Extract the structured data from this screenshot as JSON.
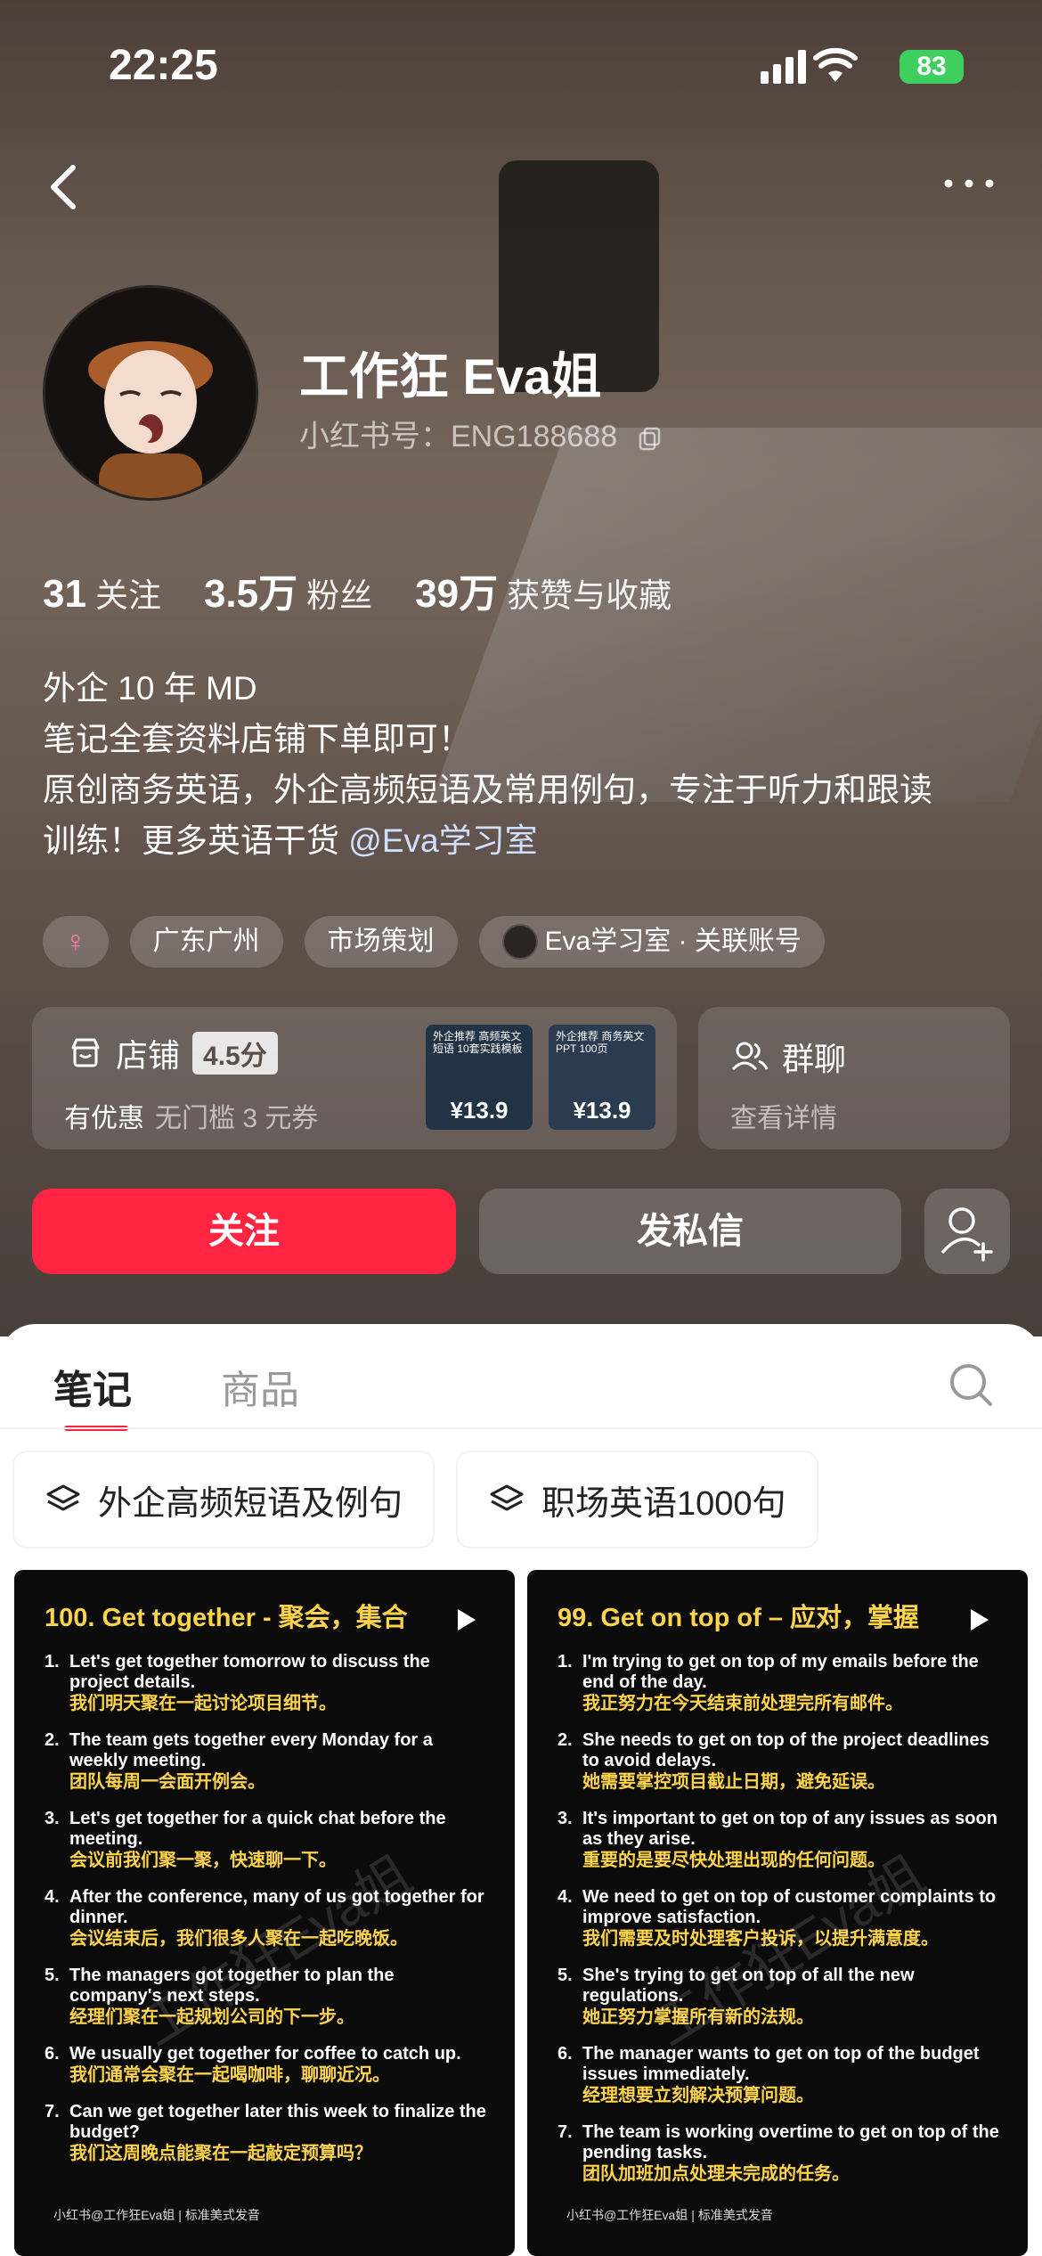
{
  "status": {
    "time": "22:25",
    "battery": "83"
  },
  "profile": {
    "name": "工作狂 Eva姐",
    "id_label": "小红书号：ENG188688",
    "stats": [
      {
        "num": "31",
        "label": "关注"
      },
      {
        "num": "3.5万",
        "label": "粉丝"
      },
      {
        "num": "39万",
        "label": "获赞与收藏"
      }
    ],
    "bio": [
      "外企 10 年 MD",
      "笔记全套资料店铺下单即可！",
      "原创商务英语，外企高频短语及常用例句，专注于听力和跟读",
      "训练！更多英语干货 "
    ],
    "bio_mention": "@Eva学习室",
    "tags": [
      "广东广州",
      "市场策划",
      "Eva学习室 · 关联账号"
    ],
    "gender_symbol": "♀"
  },
  "shop": {
    "title": "店铺",
    "score": "4.5分",
    "promo": "有优惠",
    "promo_detail": "无门槛 3 元券",
    "products": [
      {
        "title": "外企推荐 高频英文短语 10套实践模板",
        "price": "¥13.9"
      },
      {
        "title": "外企推荐 商务英文PPT 100页",
        "price": "¥13.9"
      }
    ]
  },
  "group": {
    "title": "群聊",
    "sub": "查看详情"
  },
  "buttons": {
    "follow": "关注",
    "message": "发私信"
  },
  "tabs": {
    "notes": "笔记",
    "goods": "商品"
  },
  "collections": [
    "外企高频短语及例句",
    "职场英语1000句"
  ],
  "notes": [
    {
      "title": "100. Get together - 聚会，集合",
      "items": [
        {
          "en": "Let's get together tomorrow to discuss the project details.",
          "zh": "我们明天聚在一起讨论项目细节。"
        },
        {
          "en": "The team gets together every Monday for a weekly meeting.",
          "zh": "团队每周一会面开例会。"
        },
        {
          "en": "Let's get together for a quick chat before the meeting.",
          "zh": "会议前我们聚一聚，快速聊一下。"
        },
        {
          "en": "After the conference, many of us got together for dinner.",
          "zh": "会议结束后，我们很多人聚在一起吃晚饭。"
        },
        {
          "en": "The managers got together to plan the company's next steps.",
          "zh": "经理们聚在一起规划公司的下一步。"
        },
        {
          "en": "We usually get together for coffee to catch up.",
          "zh": "我们通常会聚在一起喝咖啡，聊聊近况。"
        },
        {
          "en": "Can we get together later this week to finalize the budget?",
          "zh": "我们这周晚点能聚在一起敲定预算吗？"
        }
      ],
      "footer": "小红书@工作狂Eva姐 | 标准美式发音",
      "watermark": "工作狂Eva姐"
    },
    {
      "title": "99. Get on top of – 应对，掌握",
      "items": [
        {
          "en": "I'm trying to get on top of my emails before the end of the day.",
          "zh": "我正努力在今天结束前处理完所有邮件。"
        },
        {
          "en": "She needs to get on top of the project deadlines to avoid delays.",
          "zh": "她需要掌控项目截止日期，避免延误。"
        },
        {
          "en": "It's important to get on top of any issues as soon as they arise.",
          "zh": "重要的是要尽快处理出现的任何问题。"
        },
        {
          "en": "We need to get on top of customer complaints to improve satisfaction.",
          "zh": "我们需要及时处理客户投诉，以提升满意度。"
        },
        {
          "en": "She's trying to get on top of all the new regulations.",
          "zh": "她正努力掌握所有新的法规。"
        },
        {
          "en": "The manager wants to get on top of the budget issues immediately.",
          "zh": "经理想要立刻解决预算问题。"
        },
        {
          "en": "The team is working overtime to get on top of the pending tasks.",
          "zh": "团队加班加点处理未完成的任务。"
        }
      ],
      "footer": "小红书@工作狂Eva姐 | 标准美式发音",
      "watermark": "工作狂Eva姐"
    }
  ]
}
